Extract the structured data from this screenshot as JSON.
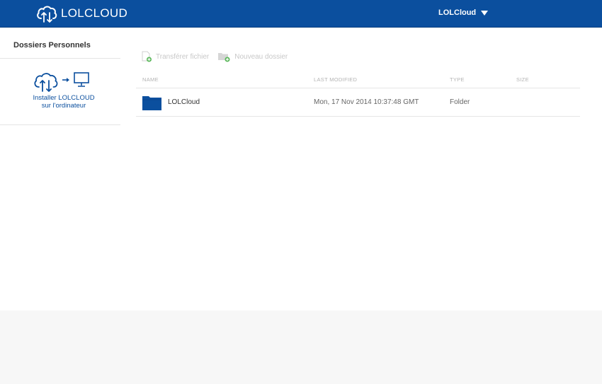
{
  "header": {
    "logo_text": "LOLCLOUD",
    "user_menu_label": "LOLCloud",
    "brand_color": "#0b4f9e"
  },
  "sidebar": {
    "title": "Dossiers Personnels",
    "install": {
      "line1": "Installer LOLCLOUD",
      "line2": "sur l'ordinateur",
      "icons": [
        "cloud-sync-icon",
        "arrow-right-icon",
        "monitor-icon"
      ]
    }
  },
  "toolbar": {
    "upload_label": "Transférer fichier",
    "new_folder_label": "Nouveau dossier"
  },
  "table": {
    "columns": [
      "NAME",
      "LAST MODIFIED",
      "TYPE",
      "SIZE"
    ],
    "rows": [
      {
        "name": "LOLCloud",
        "modified": "Mon, 17 Nov 2014 10:37:48 GMT",
        "type": "Folder",
        "size": "",
        "icon": "folder-icon"
      }
    ]
  }
}
